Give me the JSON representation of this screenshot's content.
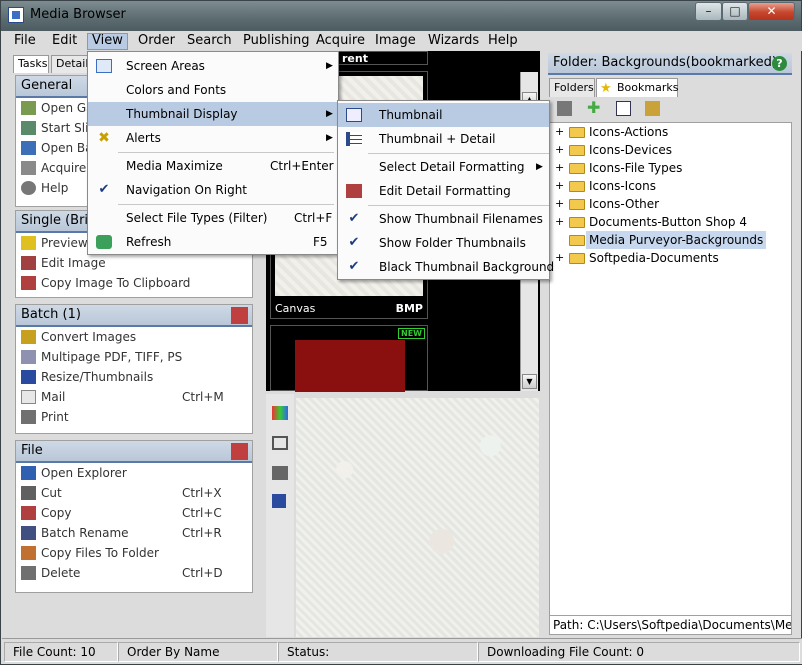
{
  "window": {
    "title": "Media Browser"
  },
  "title_buttons": {
    "minimize": "–",
    "maximize": "□",
    "close": "✕"
  },
  "menubar": [
    "File",
    "Edit",
    "View",
    "Order",
    "Search",
    "Publishing",
    "Acquire",
    "Image",
    "Wizards",
    "Help"
  ],
  "left_tabs": [
    "Tasks",
    "Details"
  ],
  "panels": {
    "general": {
      "title": "General",
      "items": [
        "Open Ga",
        "Start Slid",
        "Open Ba",
        "Acquire",
        "Help"
      ]
    },
    "single": {
      "title": "Single (Brig",
      "items": [
        "Preview",
        "Edit Image",
        "Copy Image To Clipboard"
      ]
    },
    "batch": {
      "title": "Batch (1)",
      "items": [
        {
          "label": "Convert Images",
          "shortcut": ""
        },
        {
          "label": "Multipage PDF, TIFF, PS",
          "shortcut": ""
        },
        {
          "label": "Resize/Thumbnails",
          "shortcut": ""
        },
        {
          "label": "Mail",
          "shortcut": "Ctrl+M"
        },
        {
          "label": "Print",
          "shortcut": ""
        }
      ]
    },
    "file": {
      "title": "File",
      "items": [
        {
          "label": "Open Explorer",
          "shortcut": ""
        },
        {
          "label": "Cut",
          "shortcut": "Ctrl+X"
        },
        {
          "label": "Copy",
          "shortcut": "Ctrl+C"
        },
        {
          "label": "Batch Rename",
          "shortcut": "Ctrl+R"
        },
        {
          "label": "Copy Files To Folder",
          "shortcut": ""
        },
        {
          "label": "Delete",
          "shortcut": "Ctrl+D"
        }
      ]
    }
  },
  "thumbnails": {
    "top_label": "rent",
    "canvas": {
      "name": "Canvas",
      "type": "BMP"
    },
    "new_badge": "NEW"
  },
  "view_menu": [
    {
      "label": "Screen Areas",
      "shortcut": "",
      "submenu": true
    },
    {
      "label": "Colors and Fonts",
      "shortcut": "",
      "submenu": false
    },
    {
      "label": "Thumbnail Display",
      "shortcut": "",
      "submenu": true
    },
    {
      "label": "Alerts",
      "shortcut": "",
      "submenu": true
    },
    {
      "label": "Media Maximize",
      "shortcut": "Ctrl+Enter",
      "submenu": false
    },
    {
      "label": "Navigation On Right",
      "shortcut": "",
      "submenu": false
    },
    {
      "label": "Select File Types (Filter)",
      "shortcut": "Ctrl+F",
      "submenu": false
    },
    {
      "label": "Refresh",
      "shortcut": "F5",
      "submenu": false
    }
  ],
  "thumb_submenu": [
    "Thumbnail",
    "Thumbnail + Detail",
    "Select Detail Formatting",
    "Edit Detail Formatting",
    "Show Thumbnail Filenames",
    "Show Folder Thumbnails",
    "Black Thumbnail Background"
  ],
  "right_pane": {
    "folder_title": "Folder: Backgrounds(bookmarked)",
    "help": "?",
    "tabs": [
      "Folders",
      "Bookmarks"
    ],
    "tree": [
      "Icons-Actions",
      "Icons-Devices",
      "Icons-File Types",
      "Icons-Icons",
      "Icons-Other",
      "Documents-Button Shop 4",
      "Media Purveyor-Backgrounds",
      "Softpedia-Documents"
    ],
    "path": "Path: C:\\Users\\Softpedia\\Documents\\Media"
  },
  "status": {
    "file_count": "File Count: 10",
    "order": "Order By Name",
    "status": "Status:",
    "downloading": "Downloading File Count: 0"
  },
  "colors": {
    "menu_highlight": "#b9cbe2",
    "panel_header": "#b9c7d8",
    "panel_rule": "#5b79a6"
  }
}
